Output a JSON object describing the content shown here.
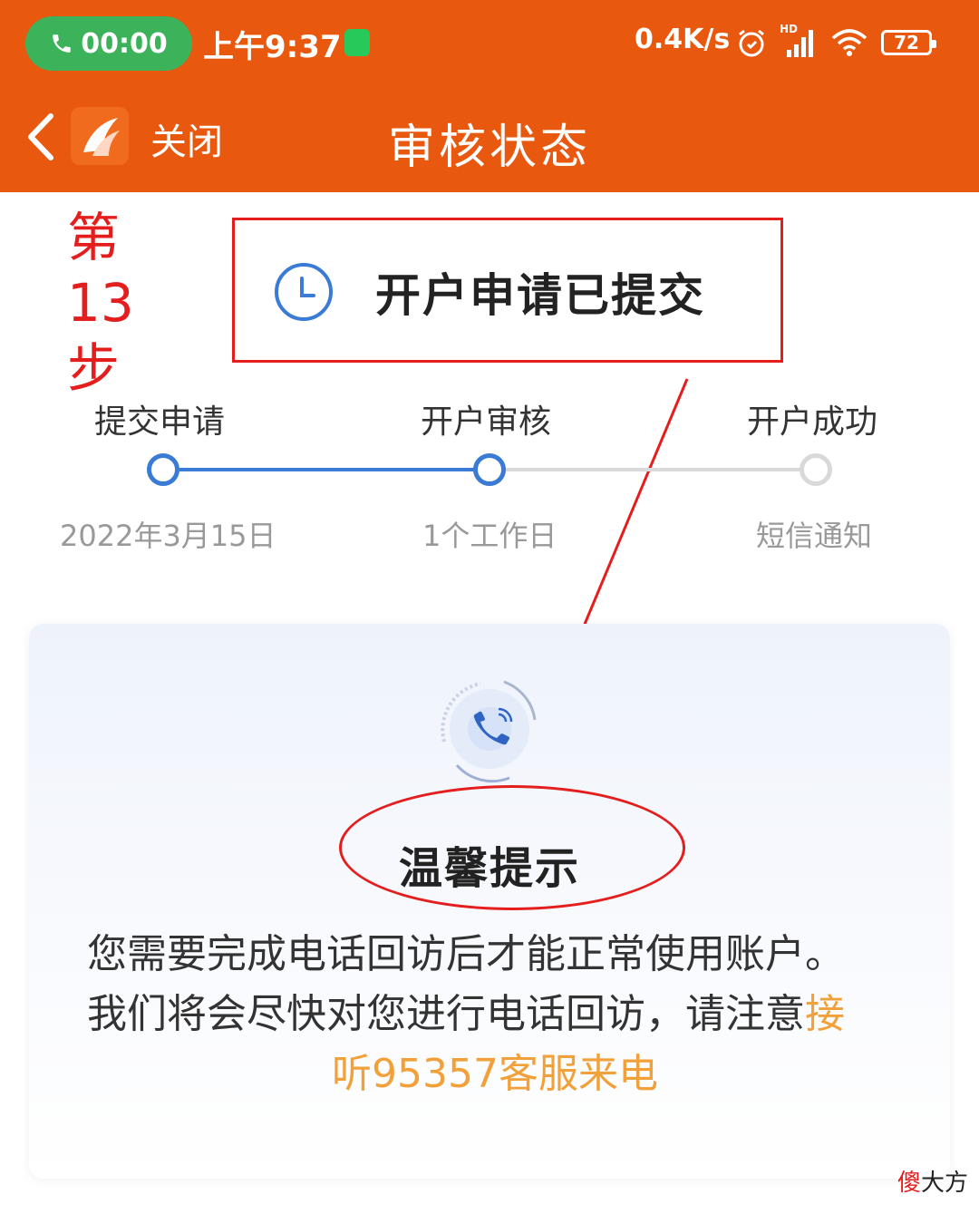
{
  "status_bar": {
    "call_timer": "00:00",
    "time": "上午9:37",
    "net_speed": "0.4K/s",
    "signal_badge": "HD",
    "battery": "72"
  },
  "header": {
    "close_label": "关闭",
    "title": "审核状态"
  },
  "annotation": {
    "step_lines": [
      "第",
      "13",
      "步"
    ]
  },
  "status": {
    "text": "开户申请已提交",
    "icon": "clock-icon"
  },
  "progress": {
    "steps": [
      {
        "title": "提交申请",
        "sub": "2022年3月15日"
      },
      {
        "title": "开户审核",
        "sub": "1个工作日"
      },
      {
        "title": "开户成功",
        "sub": "短信通知"
      }
    ],
    "current_step": 2,
    "active_color": "#3a7bd5",
    "inactive_color": "#d9d9d9"
  },
  "tip": {
    "title": "温馨提示",
    "line1": "您需要完成电话回访后才能正常使用账户。",
    "line2a": "我们将会尽快对您进行电话回访，请注意",
    "line2b": "接",
    "line3": "听95357客服来电"
  },
  "watermark": {
    "first": "傻",
    "rest": "大方"
  },
  "colors": {
    "header_bg": "#e8580e",
    "annotation_red": "#e41d1d",
    "highlight": "#f2a13a"
  }
}
